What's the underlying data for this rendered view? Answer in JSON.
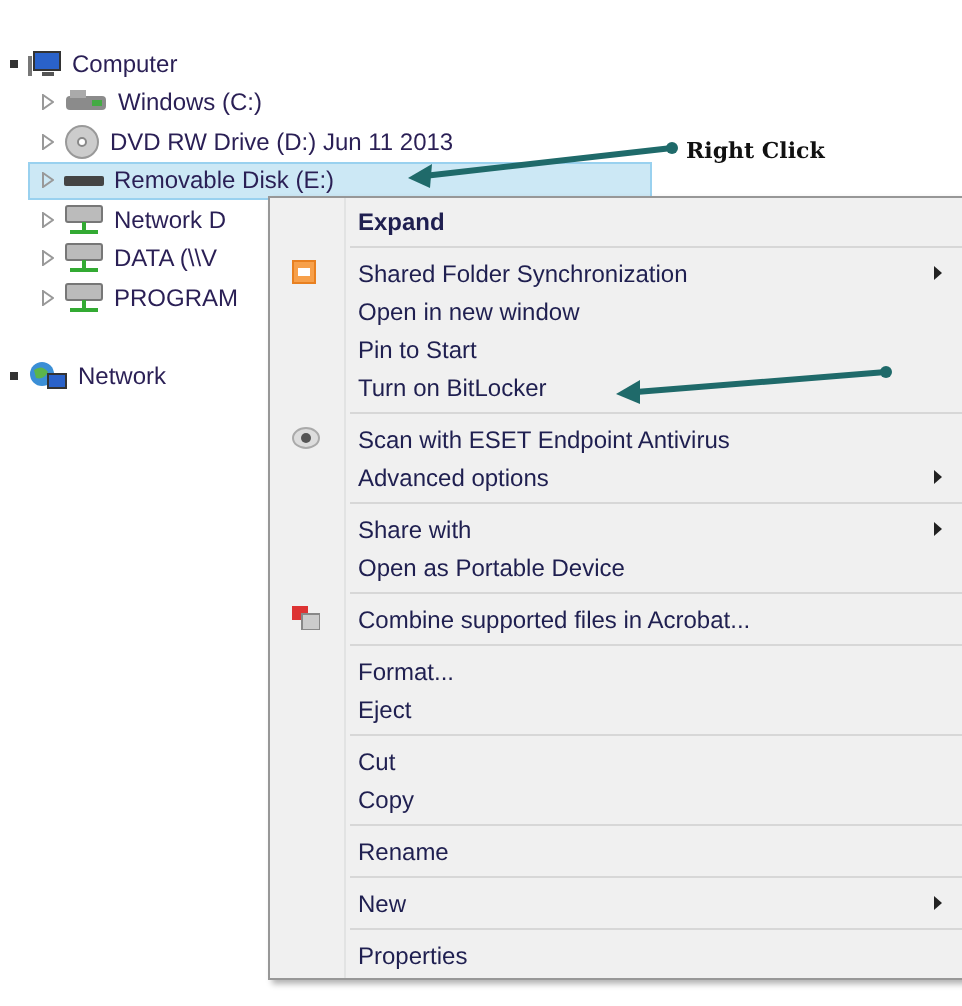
{
  "tree": [
    {
      "label": "Computer",
      "kind": "computer",
      "expanded": true,
      "selected": false,
      "children": [
        {
          "label": "Windows (C:)",
          "kind": "drive",
          "expanded": false,
          "selected": false
        },
        {
          "label": "DVD RW Drive (D:) Jun 11 2013",
          "kind": "dvd",
          "expanded": false,
          "selected": false
        },
        {
          "label": "Removable Disk (E:)",
          "kind": "removable",
          "expanded": false,
          "selected": true
        },
        {
          "label": "Network D",
          "kind": "network-drive",
          "expanded": false,
          "selected": false
        },
        {
          "label": "DATA (\\\\V",
          "kind": "network-drive",
          "expanded": false,
          "selected": false
        },
        {
          "label": "PROGRAM",
          "kind": "network-drive",
          "expanded": false,
          "selected": false
        }
      ]
    },
    {
      "label": "Network",
      "kind": "network",
      "expanded": true,
      "selected": false
    }
  ],
  "annotation": {
    "label": "Right Click"
  },
  "context_menu": {
    "groups": [
      [
        {
          "label": "Expand",
          "default": true
        }
      ],
      [
        {
          "label": "Shared Folder Synchronization",
          "kind": "sync",
          "submenu": true
        },
        {
          "label": "Open in new window"
        },
        {
          "label": "Pin to Start"
        },
        {
          "label": "Turn on BitLocker"
        }
      ],
      [
        {
          "label": "Scan with ESET Endpoint Antivirus",
          "kind": "scan"
        },
        {
          "label": "Advanced options",
          "submenu": true
        }
      ],
      [
        {
          "label": "Share with",
          "submenu": true
        },
        {
          "label": "Open as Portable Device"
        }
      ],
      [
        {
          "label": "Combine supported files in Acrobat...",
          "kind": "acrobat"
        }
      ],
      [
        {
          "label": "Format..."
        },
        {
          "label": "Eject"
        }
      ],
      [
        {
          "label": "Cut"
        },
        {
          "label": "Copy"
        }
      ],
      [
        {
          "label": "Rename"
        }
      ],
      [
        {
          "label": "New",
          "submenu": true
        }
      ],
      [
        {
          "label": "Properties"
        }
      ]
    ]
  }
}
